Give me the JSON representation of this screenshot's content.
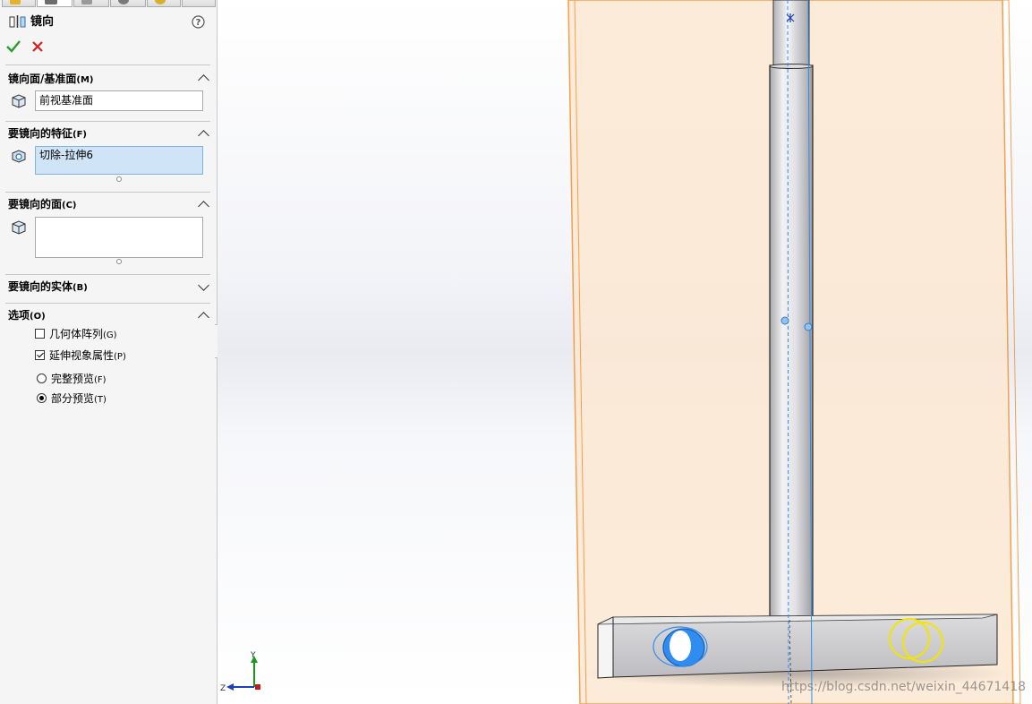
{
  "feature": {
    "title": "镜向",
    "help_icon": "question-mark-icon",
    "ok_icon": "green-checkmark-icon",
    "cancel_icon": "red-x-icon"
  },
  "sections": {
    "mirror_plane": {
      "title": "镜向面/基准面",
      "shortcut": "(M)",
      "value": "前视基准面"
    },
    "features_to_mirror": {
      "title": "要镜向的特征",
      "shortcut": "(F)",
      "value": "切除-拉伸6"
    },
    "faces_to_mirror": {
      "title": "要镜向的面",
      "shortcut": "(C)",
      "value": ""
    },
    "bodies_to_mirror": {
      "title": "要镜向的实体",
      "shortcut": "(B)"
    },
    "options": {
      "title": "选项",
      "shortcut": "(O)",
      "geometry_pattern": {
        "label": "几何体阵列",
        "shortcut": "(G)",
        "checked": false
      },
      "propagate_visual": {
        "label": "延伸视象属性",
        "shortcut": "(P)",
        "checked": true
      },
      "full_preview": {
        "label": "完整预览",
        "shortcut": "(F)",
        "selected": false
      },
      "partial_preview": {
        "label": "部分预览",
        "shortcut": "(T)",
        "selected": true
      }
    }
  },
  "triad": {
    "y_label": "Y",
    "z_label": "Z"
  },
  "watermark": "https://blog.csdn.net/weixin_44671418",
  "colors": {
    "plane_fill": "#fde7d2",
    "plane_edge": "#f0a050",
    "selection_blue": "#2f8cf0",
    "highlight_yellow": "#f2e600",
    "ok_green": "#2e9b2e",
    "cancel_red": "#d42020"
  }
}
